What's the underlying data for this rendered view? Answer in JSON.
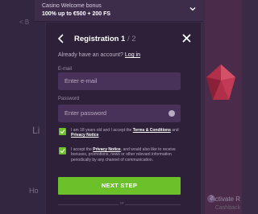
{
  "background": {
    "back_label": "< B",
    "left_text": "Li",
    "bottom_text": "Ho",
    "step_number": "2",
    "activate_label": "Activate R",
    "cashback_label": "Cashback"
  },
  "bonus_bar": {
    "title": "Casino Welcome bonus",
    "amount": "100% up to €500 + 200 FS",
    "icon": "chevron-down-icon"
  },
  "modal": {
    "title": "Registration 1",
    "step_sep": " / 2",
    "back_icon": "back-arrow-icon",
    "close_icon": "close-icon",
    "have_account_text": "Already have an account?",
    "login_link": "Log in",
    "email": {
      "label": "E-mail",
      "placeholder": "Enter e-mail",
      "value": ""
    },
    "password": {
      "label": "Password",
      "placeholder": "Enter password",
      "value": "",
      "icon": "eye-icon"
    },
    "consent_terms": {
      "checked": true,
      "text_a": "I am 18 years old and I accept the ",
      "link_terms": "Terms & Conditions",
      "text_b": " and ",
      "link_privacy": "Privacy Notice"
    },
    "consent_marketing": {
      "checked": true,
      "text_a": "I accept the ",
      "link_privacy": "Privacy Notice",
      "text_b": ", and would also like to receive bonuses, promotions, news or other relevant information periodically by any channel of communication."
    },
    "next_button": "NEXT STEP",
    "or_text": "or"
  },
  "colors": {
    "accent_green": "#6cc12a",
    "modal_bg": "#2e2038",
    "field_bg": "#48325a"
  }
}
